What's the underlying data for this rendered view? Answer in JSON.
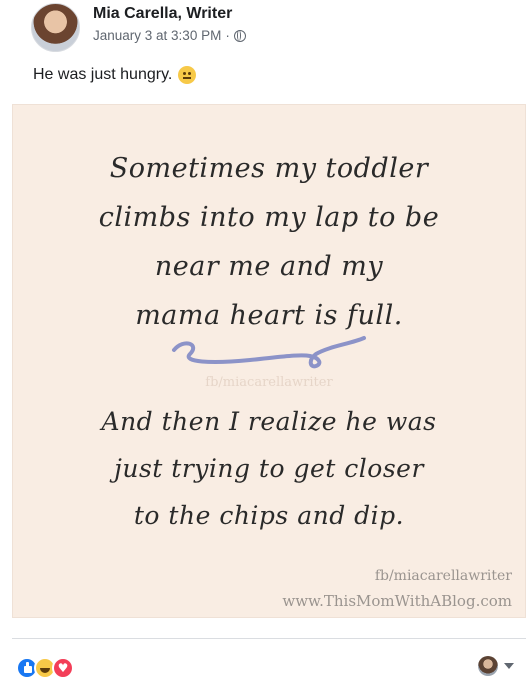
{
  "post": {
    "author": "Mia Carella, Writer",
    "timestamp": "January 3 at 3:30 PM",
    "separator": "·",
    "privacy_icon": "globe-icon",
    "caption": "He was just hungry.",
    "caption_emoji": "grimacing-face-emoji"
  },
  "quote": {
    "top_lines": [
      "Sometimes my toddler",
      "climbs into my lap to be",
      "near me and my",
      "mama heart is full."
    ],
    "bottom_lines": [
      "And then I realize he was",
      "just trying to get closer",
      "to the chips and dip."
    ],
    "watermark": "fb/miacarellawriter",
    "credit_fb": "fb/miacarellawriter",
    "credit_url": "www.ThisMomWithABlog.com",
    "swirl_color": "#8c93c8"
  },
  "reactions": {
    "icons": [
      "like-icon",
      "haha-icon",
      "love-icon"
    ],
    "colors": {
      "like": "#1877f2",
      "haha": "#f7c948",
      "love": "#f33e58"
    }
  }
}
